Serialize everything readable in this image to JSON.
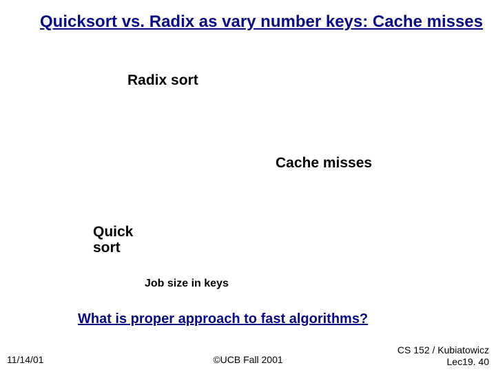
{
  "title": "Quicksort vs. Radix as vary number keys: Cache misses",
  "labels": {
    "radix": "Radix sort",
    "cache": "Cache misses",
    "quick_line1": "Quick",
    "quick_line2": "sort",
    "xaxis": "Job size in keys"
  },
  "question": "What is proper approach to fast algorithms?",
  "footer": {
    "date": "11/14/01",
    "center": "©UCB Fall 2001",
    "right_line1": "CS 152 / Kubiatowicz",
    "right_line2": "Lec19. 40"
  },
  "chart_data": {
    "type": "line",
    "title": "Quicksort vs. Radix as vary number keys: Cache misses",
    "xlabel": "Job size in keys",
    "ylabel": "Cache misses",
    "series": [
      {
        "name": "Radix sort",
        "values": []
      },
      {
        "name": "Quick sort",
        "values": []
      }
    ],
    "note": "No plotted data visible in image; only labels shown."
  }
}
